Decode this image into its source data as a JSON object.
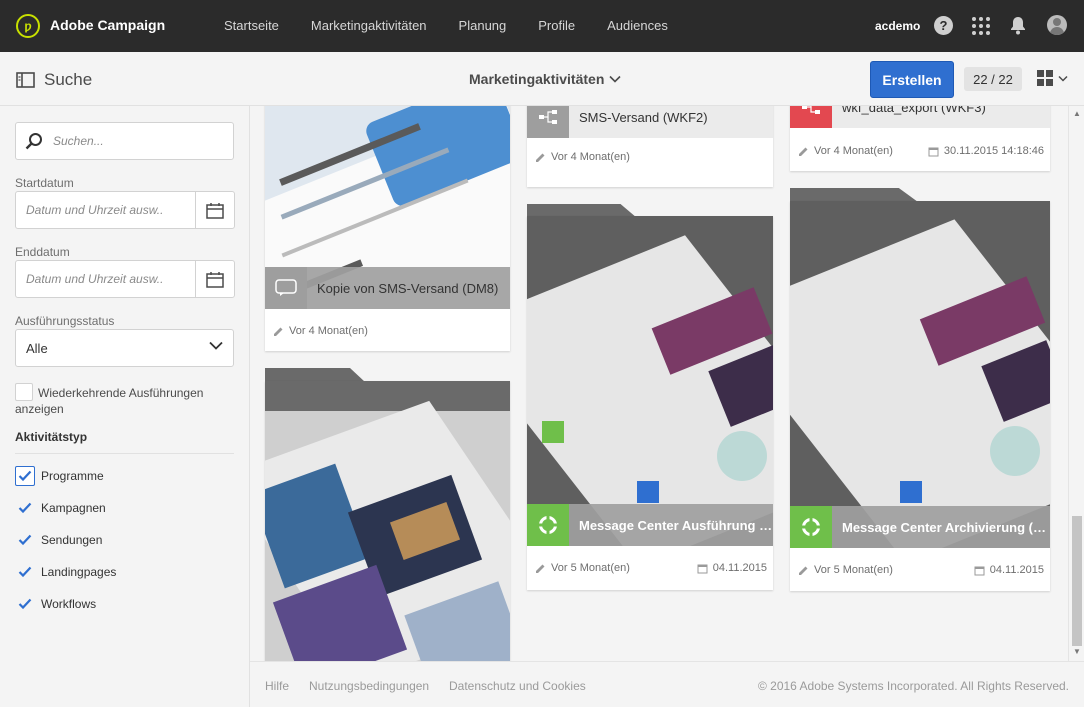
{
  "header": {
    "app_title": "Adobe Campaign",
    "nav": [
      "Startseite",
      "Marketingaktivitäten",
      "Planung",
      "Profile",
      "Audiences"
    ],
    "user": "acdemo",
    "help_glyph": "?"
  },
  "actionbar": {
    "search_label": "Suche",
    "context_title": "Marketingaktivitäten",
    "create_label": "Erstellen",
    "count": "22 / 22"
  },
  "filters": {
    "search_placeholder": "Suchen...",
    "start_label": "Startdatum",
    "start_placeholder": "Datum und Uhrzeit ausw..",
    "end_label": "Enddatum",
    "end_placeholder": "Datum und Uhrzeit ausw..",
    "status_label": "Ausführungsstatus",
    "status_value": "Alle",
    "recurring_label": "Wiederkehrende Ausführungen anzeigen",
    "type_title": "Aktivitätstyp",
    "types": [
      {
        "label": "Programme",
        "checked": true
      },
      {
        "label": "Kampagnen",
        "checked": true
      },
      {
        "label": "Sendungen",
        "checked": true
      },
      {
        "label": "Landingpages",
        "checked": true
      },
      {
        "label": "Workflows",
        "checked": true
      }
    ]
  },
  "cards": [
    {
      "title": "Kopie von SMS-Versand (DM8)",
      "modified": "Vor 4 Monat(en)",
      "date": "",
      "icon": "sms-icon",
      "color": "#9e9e9e"
    },
    {
      "title": "SMS-Versand (WKF2)",
      "modified": "Vor 4 Monat(en)",
      "date": "",
      "icon": "workflow-icon",
      "color": "#9e9e9e"
    },
    {
      "title": "wkf_data_export (WKF3)",
      "modified": "Vor 4 Monat(en)",
      "date": "30.11.2015 14:18:46",
      "icon": "workflow-icon",
      "color": "#e34850"
    },
    {
      "title": "Message Center Ausführung (...",
      "modified": "Vor 5 Monat(en)",
      "date": "04.11.2015",
      "icon": "program-icon",
      "color": "#6fbf4a"
    },
    {
      "title": "Message Center Archivierung (m...",
      "modified": "Vor 5 Monat(en)",
      "date": "04.11.2015",
      "icon": "program-icon",
      "color": "#6fbf4a"
    }
  ],
  "footer": {
    "links": [
      "Hilfe",
      "Nutzungsbedingungen",
      "Datenschutz und Cookies"
    ],
    "copyright": "© 2016 Adobe Systems Incorporated. All Rights Reserved."
  },
  "colors": {
    "topbar": "#2b2b2b",
    "accent": "#2f6fd0",
    "logo": "#c8e000",
    "program": "#6fbf4a",
    "workflow_red": "#e34850"
  }
}
